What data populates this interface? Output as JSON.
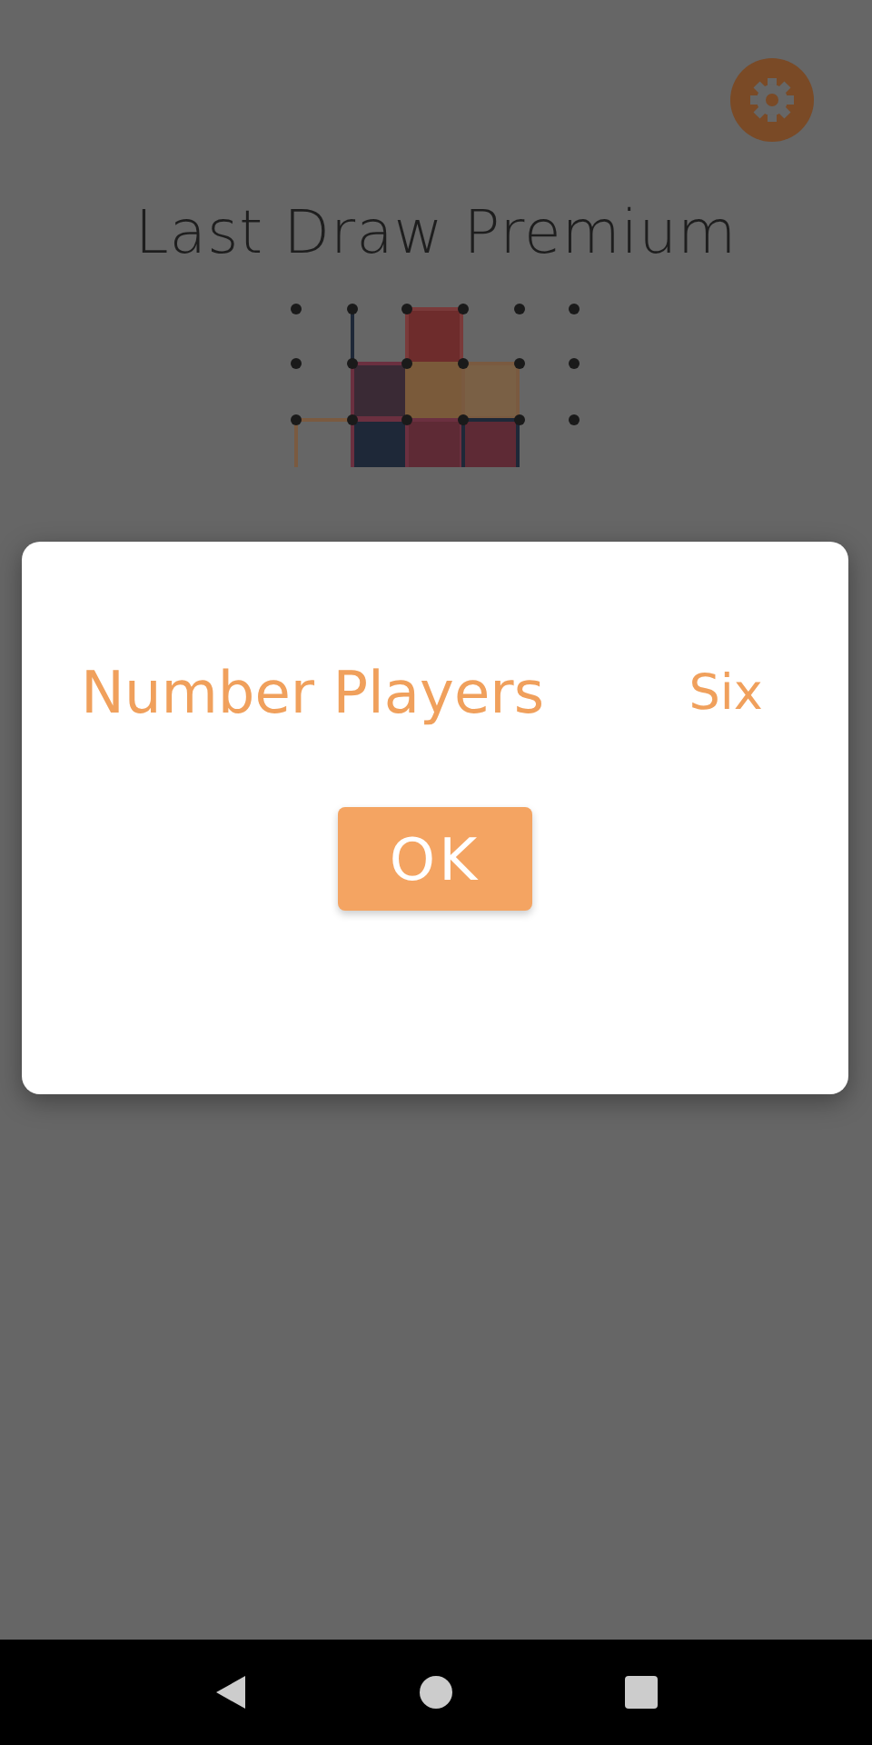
{
  "app_title": "Last Draw Premium",
  "dialog": {
    "label": "Number Players",
    "value": "Six",
    "button": "OK"
  }
}
